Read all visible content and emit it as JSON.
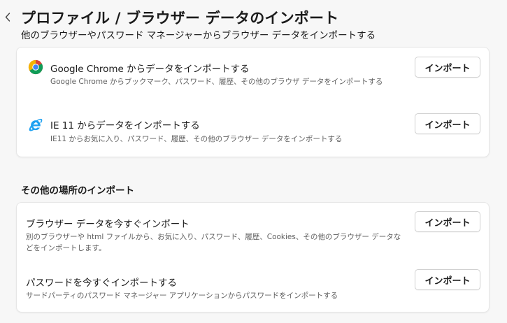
{
  "header": {
    "title": "プロファイル / ブラウザー データのインポート",
    "subtitle": "他のブラウザーやパスワード マネージャーからブラウザー データをインポートする"
  },
  "browsers": [
    {
      "title": "Google Chrome からデータをインポートする",
      "description": "Google Chrome からブックマーク、パスワード、履歴、その他のブラウザ データをインポートする",
      "button": "インポート",
      "icon": "chrome-icon"
    },
    {
      "title": "IE 11 からデータをインポートする",
      "description": "IE11 からお気に入り、パスワード、履歴、その他のブラウザー データをインポートする",
      "button": "インポート",
      "icon": "internet-explorer-icon"
    }
  ],
  "other_section": {
    "heading": "その他の場所のインポート",
    "items": [
      {
        "title": "ブラウザー データを今すぐインポート",
        "description": "別のブラウザーや html ファイルから、お気に入り、パスワード、履歴、Cookies、その他のブラウザー データなどをインポートします。",
        "button": "インポート"
      },
      {
        "title": "パスワードを今すぐインポートする",
        "description": "サードパーティのパスワード マネージャー アプリケーションからパスワードをインポートする",
        "button": "インポート"
      }
    ]
  },
  "colors": {
    "background": "#f7f7f7",
    "card": "#ffffff",
    "chrome_red": "#db4437",
    "chrome_yellow": "#f4b400",
    "chrome_green": "#0f9d58",
    "chrome_blue": "#4285f4",
    "ie_blue": "#1ea1f1"
  }
}
